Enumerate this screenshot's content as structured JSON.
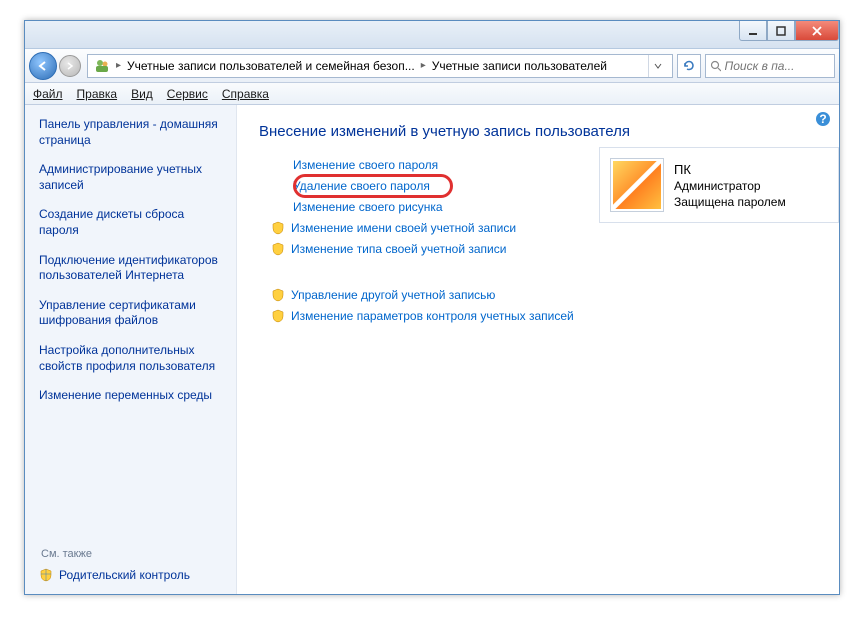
{
  "breadcrumb": {
    "part1": "Учетные записи пользователей и семейная безоп...",
    "part2": "Учетные записи пользователей"
  },
  "search": {
    "placeholder": "Поиск в па..."
  },
  "menu": {
    "file": "Файл",
    "edit": "Правка",
    "view": "Вид",
    "tools": "Сервис",
    "help": "Справка"
  },
  "sidebar": {
    "items": [
      "Панель управления - домашняя страница",
      "Администрирование учетных записей",
      "Создание дискеты сброса пароля",
      "Подключение идентификаторов пользователей Интернета",
      "Управление сертификатами шифрования файлов",
      "Настройка дополнительных свойств профиля пользователя",
      "Изменение переменных среды"
    ],
    "see_also": "См. также",
    "parental": "Родительский контроль"
  },
  "page": {
    "title": "Внесение изменений в учетную запись пользователя"
  },
  "links": {
    "l1": "Изменение своего пароля",
    "l2": "Удаление своего пароля",
    "l3": "Изменение своего рисунка",
    "l4": "Изменение имени своей учетной записи",
    "l5": "Изменение типа своей учетной записи",
    "l6": "Управление другой учетной записью",
    "l7": "Изменение параметров контроля учетных записей"
  },
  "user": {
    "name": "ПК",
    "role": "Администратор",
    "protected": "Защищена паролем"
  }
}
